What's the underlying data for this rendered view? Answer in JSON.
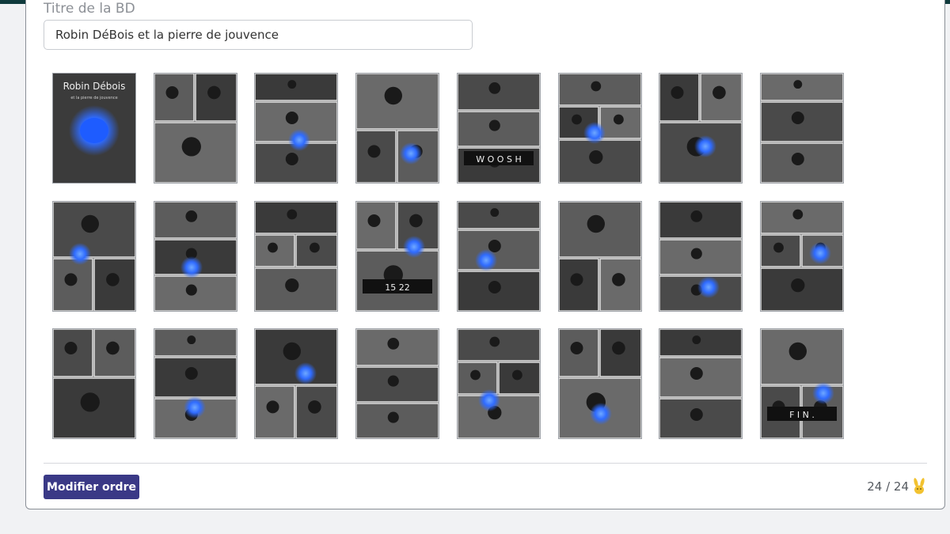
{
  "form": {
    "title_label": "Titre de la BD",
    "title_value": "Robin DéBois et la pierre de jouvence"
  },
  "pages": [
    {
      "name": "page-1-cover",
      "cover_title": "Robin Débois",
      "cover_subtitle": "et la pierre de jouvence"
    },
    {
      "name": "page-2"
    },
    {
      "name": "page-3"
    },
    {
      "name": "page-4"
    },
    {
      "name": "page-5",
      "caption": "W O O S H"
    },
    {
      "name": "page-6"
    },
    {
      "name": "page-7"
    },
    {
      "name": "page-8"
    },
    {
      "name": "page-9"
    },
    {
      "name": "page-10"
    },
    {
      "name": "page-11"
    },
    {
      "name": "page-12",
      "caption": "15 22"
    },
    {
      "name": "page-13"
    },
    {
      "name": "page-14"
    },
    {
      "name": "page-15"
    },
    {
      "name": "page-16"
    },
    {
      "name": "page-17"
    },
    {
      "name": "page-18"
    },
    {
      "name": "page-19"
    },
    {
      "name": "page-20"
    },
    {
      "name": "page-21"
    },
    {
      "name": "page-22"
    },
    {
      "name": "page-23"
    },
    {
      "name": "page-24-end",
      "caption": "F I N ."
    }
  ],
  "footer": {
    "reorder_button": "Modifier ordre",
    "counter": "24 / 24",
    "counter_icon": "rabbit-icon"
  },
  "colors": {
    "topbar": "#0f3a3c",
    "button": "#3a3986",
    "glow": "#2f6bff"
  }
}
